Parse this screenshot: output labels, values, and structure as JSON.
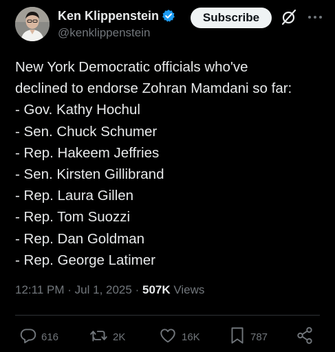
{
  "author": {
    "display_name": "Ken Klippenstein",
    "handle": "@kenklippenstein",
    "verified_icon": "verified-badge-icon",
    "verified_color": "#1d9bf0"
  },
  "header": {
    "subscribe_label": "Subscribe",
    "grok_icon": "grok-icon",
    "more_icon": "more-horizontal-icon"
  },
  "tweet": {
    "lines": [
      "New York Democratic officials who've",
      "declined to endorse Zohran Mamdani so far:",
      "- Gov. Kathy Hochul",
      "- Sen. Chuck Schumer",
      "- Rep. Hakeem Jeffries",
      "- Sen. Kirsten Gillibrand",
      "- Rep. Laura Gillen",
      "- Rep. Tom Suozzi",
      "- Rep. Dan Goldman",
      "- Rep. George Latimer"
    ]
  },
  "meta": {
    "time": "12:11 PM",
    "date": "Jul 1, 2025",
    "views_count": "507K",
    "views_label": "Views",
    "separator": "·"
  },
  "actions": {
    "replies": "616",
    "reposts": "2K",
    "likes": "16K",
    "bookmarks": "787"
  },
  "colors": {
    "background": "#000000",
    "text": "#e7e9ea",
    "secondary": "#71767b",
    "divider": "#2f3336"
  }
}
